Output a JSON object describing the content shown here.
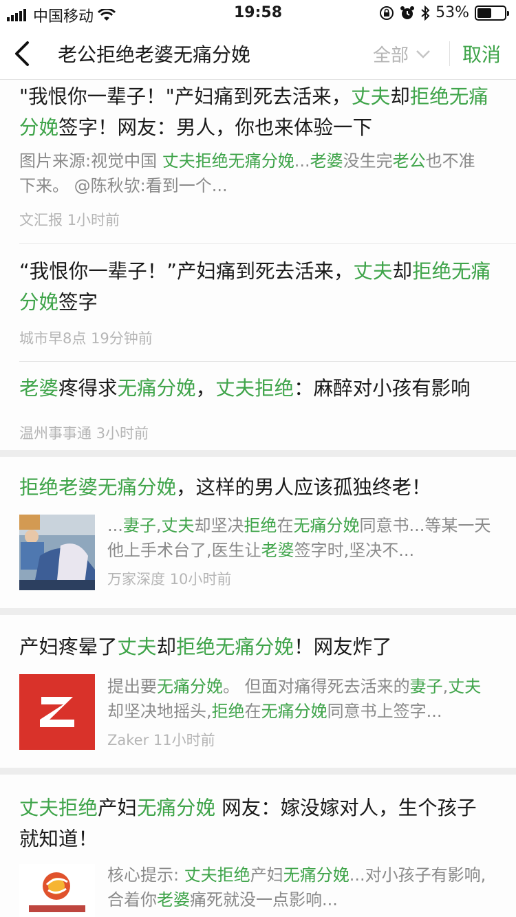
{
  "status_bar": {
    "carrier": "中国移动",
    "time": "19:58",
    "battery_percent": "53%",
    "battery_level": 0.53
  },
  "header": {
    "search_query": "老公拒绝老婆无痛分娩",
    "filter_label": "全部",
    "cancel_label": "取消"
  },
  "results": [
    {
      "title": [
        {
          "t": "\"我恨你一辈子！\"产妇痛到死去活来，",
          "hl": false
        },
        {
          "t": "丈夫",
          "hl": true
        },
        {
          "t": "却",
          "hl": false
        },
        {
          "t": "拒绝无痛分娩",
          "hl": true
        },
        {
          "t": "签字！网友：男人，你也来体验一下",
          "hl": false
        }
      ],
      "summary": [
        {
          "t": "图片来源:视觉中国 ",
          "hl": false
        },
        {
          "t": "丈夫拒绝无痛分娩",
          "hl": true
        },
        {
          "t": "...",
          "hl": false
        },
        {
          "t": "老婆",
          "hl": true
        },
        {
          "t": "没生完",
          "hl": false
        },
        {
          "t": "老公",
          "hl": true
        },
        {
          "t": "也不准下来。 @陈秋欤:看到一个...",
          "hl": false
        }
      ],
      "source": "文汇报",
      "time": "1小时前"
    },
    {
      "title": [
        {
          "t": "“我恨你一辈子！”产妇痛到死去活来，",
          "hl": false
        },
        {
          "t": "丈夫",
          "hl": true
        },
        {
          "t": "却",
          "hl": false
        },
        {
          "t": "拒绝无痛分娩",
          "hl": true
        },
        {
          "t": "签字",
          "hl": false
        }
      ],
      "source": "城市早8点",
      "time": "19分钟前"
    },
    {
      "title": [
        {
          "t": "老婆",
          "hl": true
        },
        {
          "t": "疼得求",
          "hl": false
        },
        {
          "t": "无痛分娩",
          "hl": true
        },
        {
          "t": "，",
          "hl": false
        },
        {
          "t": "丈夫拒绝",
          "hl": true
        },
        {
          "t": "：麻醉对小孩有影响",
          "hl": false
        }
      ],
      "source": "温州事事通",
      "time": "3小时前"
    },
    {
      "title": [
        {
          "t": "拒绝老婆无痛分娩",
          "hl": true
        },
        {
          "t": "，这样的男人应该孤独终老！",
          "hl": false
        }
      ],
      "summary": [
        {
          "t": "...",
          "hl": false
        },
        {
          "t": "妻子",
          "hl": true
        },
        {
          "t": ",",
          "hl": false
        },
        {
          "t": "丈夫",
          "hl": true
        },
        {
          "t": "却坚决",
          "hl": false
        },
        {
          "t": "拒绝",
          "hl": true
        },
        {
          "t": "在",
          "hl": false
        },
        {
          "t": "无痛分娩",
          "hl": true
        },
        {
          "t": "同意书...等某一天他上手术台了,医生让",
          "hl": false
        },
        {
          "t": "老婆",
          "hl": true
        },
        {
          "t": "签字时,坚决不...",
          "hl": false
        }
      ],
      "source": "万家深度",
      "time": "10小时前",
      "thumb": "surgery-photo"
    },
    {
      "title": [
        {
          "t": "产妇疼晕了",
          "hl": false
        },
        {
          "t": "丈夫",
          "hl": true
        },
        {
          "t": "却",
          "hl": false
        },
        {
          "t": "拒绝无痛分娩",
          "hl": true
        },
        {
          "t": "！网友炸了",
          "hl": false
        }
      ],
      "summary": [
        {
          "t": "提出要",
          "hl": false
        },
        {
          "t": "无痛分娩",
          "hl": true
        },
        {
          "t": "。 但面对痛得死去活来的",
          "hl": false
        },
        {
          "t": "妻子",
          "hl": true
        },
        {
          "t": ",",
          "hl": false
        },
        {
          "t": "丈夫",
          "hl": true
        },
        {
          "t": "却坚决地摇头,",
          "hl": false
        },
        {
          "t": "拒绝",
          "hl": true
        },
        {
          "t": "在",
          "hl": false
        },
        {
          "t": "无痛分娩",
          "hl": true
        },
        {
          "t": "同意书上签字...",
          "hl": false
        }
      ],
      "source": "Zaker",
      "time": "11小时前",
      "thumb": "zaker-logo",
      "thumb_color": "#d9322a"
    },
    {
      "title": [
        {
          "t": "丈夫拒绝",
          "hl": true
        },
        {
          "t": "产妇",
          "hl": false
        },
        {
          "t": "无痛分娩",
          "hl": true
        },
        {
          "t": " 网友：嫁没嫁对人，生个孩子就知道！",
          "hl": false
        }
      ],
      "summary": [
        {
          "t": "核心提示: ",
          "hl": false
        },
        {
          "t": "丈夫拒绝",
          "hl": true
        },
        {
          "t": "产妇",
          "hl": false
        },
        {
          "t": "无痛分娩",
          "hl": true
        },
        {
          "t": "...对小孩子有影响,合着你",
          "hl": false
        },
        {
          "t": "老婆",
          "hl": true
        },
        {
          "t": "痛死就没一点影响...",
          "hl": false
        }
      ],
      "thumb": "newspaper-logo"
    }
  ],
  "colors": {
    "highlight": "#3fa44a",
    "zaker_red": "#d9322a"
  }
}
